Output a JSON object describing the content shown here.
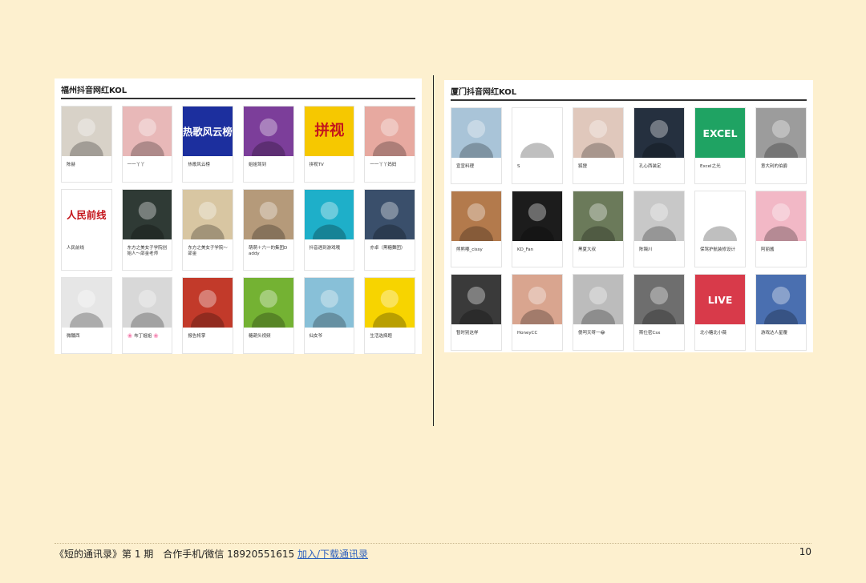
{
  "left_panel": {
    "title": "福州抖音网红KOL",
    "items": [
      {
        "label": "陈赫",
        "icon": "man-black-mask",
        "color": "#d8d2c8"
      },
      {
        "label": "一一丫丫",
        "icon": "two-girls-photo",
        "color": "#e8b8b8"
      },
      {
        "label": "热歌风云榜",
        "icon": "hot-songs-logo",
        "color": "#1c2f9e",
        "text": "热歌风云榜"
      },
      {
        "label": "姐姐驾到",
        "icon": "cartoon-queen",
        "color": "#7c3e9a"
      },
      {
        "label": "拼视TV",
        "icon": "pinshi-logo",
        "color": "#f6c800",
        "text": "拼视"
      },
      {
        "label": "一一丫丫妈妈",
        "icon": "girls-toys-photo",
        "color": "#e7a9a0"
      },
      {
        "label": "人民前线",
        "icon": "renmin-logo",
        "color": "#ffffff",
        "text": "人民前线"
      },
      {
        "label": "东方之美女子学院创始人～邵金老师",
        "icon": "woman-black-dress",
        "color": "#2f3a35"
      },
      {
        "label": "东方之美女子学院～邵金",
        "icon": "woman-qipao",
        "color": "#d8c6a2"
      },
      {
        "label": "萌萌＋六一的集团Daddy",
        "icon": "family-photo",
        "color": "#b59a7a"
      },
      {
        "label": "抖音遇到游戏哦",
        "icon": "phone-game-logo",
        "color": "#1eafc9"
      },
      {
        "label": "亦卓（黑糖舞团）",
        "icon": "boy-face",
        "color": "#3a4f6b"
      },
      {
        "label": "微醺西",
        "icon": "shadow-figure",
        "color": "#e6e6e6"
      },
      {
        "label": "🌸 布丁姐姐 🌸",
        "icon": "twin-girls",
        "color": "#d8d8d8"
      },
      {
        "label": "报告将掌",
        "icon": "cartoon-boss",
        "color": "#c23a2a"
      },
      {
        "label": "糖葫头视频",
        "icon": "cartoon-phone",
        "color": "#74b233"
      },
      {
        "label": "仙女爷",
        "icon": "girl-outdoor",
        "color": "#88c0d8"
      },
      {
        "label": "生活选择题",
        "icon": "check-logo",
        "color": "#f7d400"
      }
    ]
  },
  "right_panel": {
    "title": "厦门抖音网红KOL",
    "items": [
      {
        "label": "宣宣料理",
        "icon": "man-capitol",
        "color": "#a9c4d8"
      },
      {
        "label": "S",
        "icon": "cartoon-faces",
        "color": "#ffffff"
      },
      {
        "label": "狐狸",
        "icon": "woman-eyepatch",
        "color": "#e0c8bc"
      },
      {
        "label": "孔心西装定",
        "icon": "man-suit",
        "color": "#25303f"
      },
      {
        "label": "Excel之光",
        "icon": "excel-logo",
        "color": "#1fa363",
        "text": "EXCEL"
      },
      {
        "label": "意大利的伯爵",
        "icon": "blonde-woman",
        "color": "#9c9c9c"
      },
      {
        "label": "熊熊嘟_cissy",
        "icon": "girl-bear-hat",
        "color": "#b37a4c"
      },
      {
        "label": "KD_Fan",
        "icon": "man-dark-hair",
        "color": "#1c1c1c"
      },
      {
        "label": "黑夏大叔",
        "icon": "man-bald",
        "color": "#6b7a5a"
      },
      {
        "label": "陈镯川",
        "icon": "man-chain",
        "color": "#c8c8c8"
      },
      {
        "label": "保驾护航装修设计",
        "icon": "shield-logo",
        "color": "#ffffff"
      },
      {
        "label": "阿丽酱",
        "icon": "cartoon-cat",
        "color": "#f2b8c6"
      },
      {
        "label": "暂时别这样",
        "icon": "man-dog",
        "color": "#3a3a3a"
      },
      {
        "label": "HoneyCC",
        "icon": "smiling-woman",
        "color": "#d9a58f"
      },
      {
        "label": "傻呵天呀一😂",
        "icon": "couple-photo",
        "color": "#bcbcbc"
      },
      {
        "label": "斯仕密Csx",
        "icon": "bearded-man",
        "color": "#6e6e6e"
      },
      {
        "label": "北小糖北小薇",
        "icon": "live-hero",
        "color": "#d83a4a",
        "text": "LIVE"
      },
      {
        "label": "游戏达人星覆",
        "icon": "game-warrior",
        "color": "#4a6fb0"
      }
    ]
  },
  "footer": {
    "text": "《短的通讯录》第 1 期　合作手机/微信 18920551615",
    "link": "加入/下载通讯录",
    "page": "10"
  }
}
